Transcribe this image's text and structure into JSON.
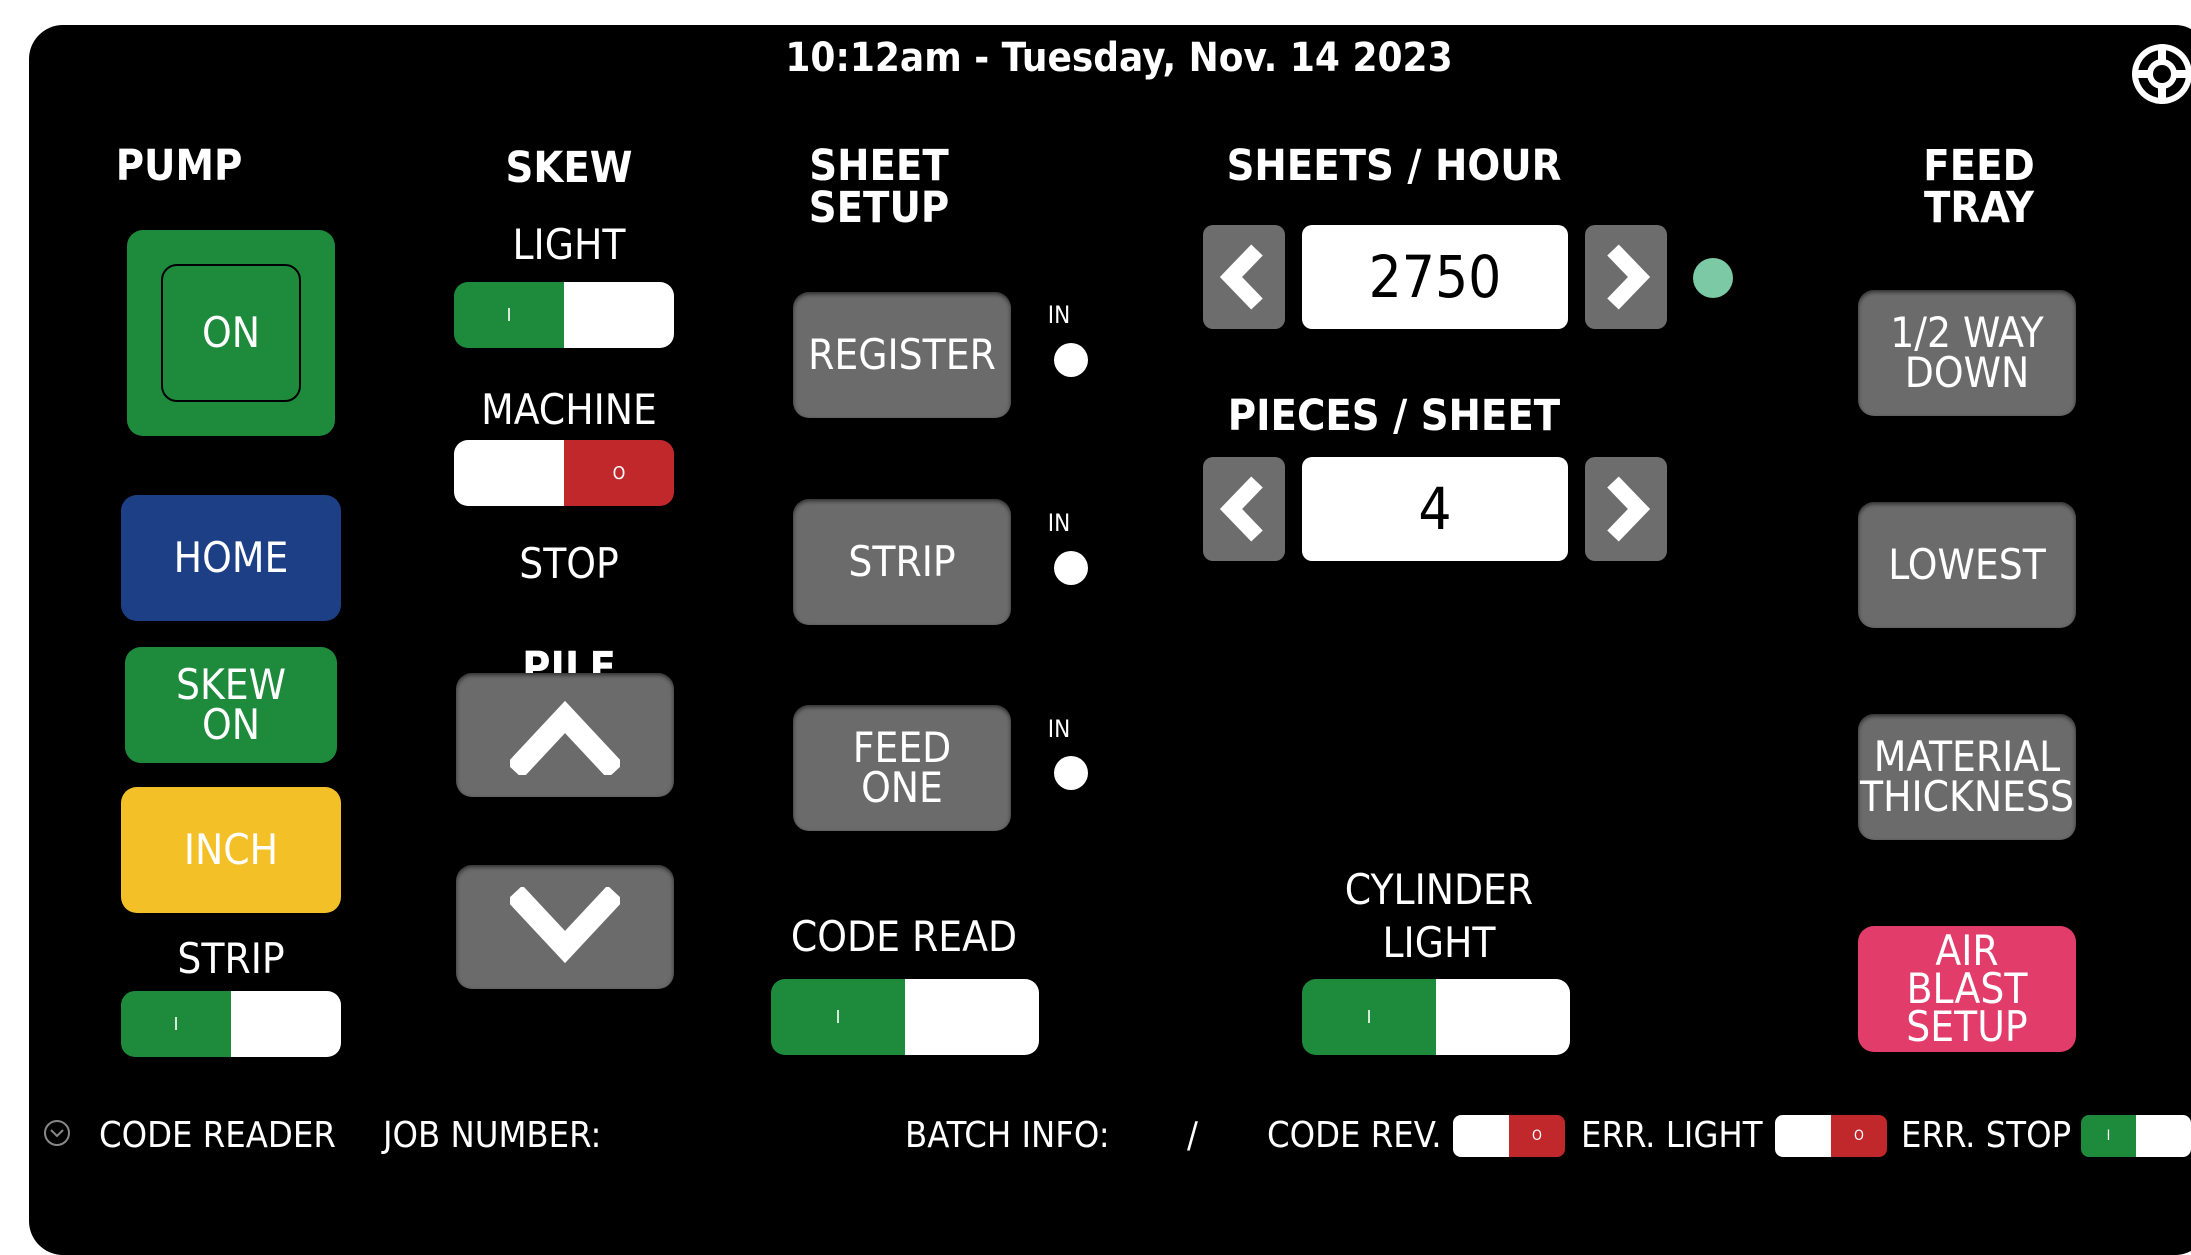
{
  "header": {
    "datetime": "10:12am - Tuesday, Nov. 14 2023",
    "settings_icon": "lifebuoy-icon"
  },
  "pump": {
    "title": "PUMP",
    "on_label": "ON",
    "home_label": "HOME",
    "skew_on_label": "SKEW ON",
    "inch_label": "INCH",
    "strip_label": "STRIP",
    "strip_toggle_on": true
  },
  "skew": {
    "title": "SKEW",
    "light_label": "LIGHT",
    "light_toggle_on": true,
    "machine_label": "MACHINE",
    "stop_label": "STOP",
    "machine_toggle_on": false
  },
  "pile": {
    "title": "PILE",
    "up_icon": "chevron-up-icon",
    "down_icon": "chevron-down-icon"
  },
  "sheet_setup": {
    "title_line1": "SHEET",
    "title_line2": "SETUP",
    "register_label": "REGISTER",
    "strip_label": "STRIP",
    "feed_one_line1": "FEED",
    "feed_one_line2": "ONE",
    "in_label": "IN",
    "code_read_label": "CODE READ",
    "code_read_toggle_on": true
  },
  "sheets_hour": {
    "title": "SHEETS / HOUR",
    "value": "2750",
    "status_color": "#7cc9a5"
  },
  "pieces_sheet": {
    "title": "PIECES / SHEET",
    "value": "4"
  },
  "cylinder": {
    "line1": "CYLINDER",
    "line2": "LIGHT",
    "toggle_on": true
  },
  "feed_tray": {
    "title_line1": "FEED",
    "title_line2": "TRAY",
    "half_way_line1": "1/2 WAY",
    "half_way_line2": "DOWN",
    "lowest_label": "LOWEST",
    "material_line1": "MATERIAL",
    "material_line2": "THICKNESS",
    "air_line1": "AIR",
    "air_line2": "BLAST",
    "air_line3": "SETUP"
  },
  "footer": {
    "code_reader_label": "CODE READER",
    "code_reader_icon": "chevron-down-circle-icon",
    "job_number_label": "JOB NUMBER:",
    "batch_info_label": "BATCH INFO:",
    "batch_sep": "/",
    "code_rev_label": "CODE REV.",
    "err_light_label": "ERR. LIGHT",
    "err_stop_label": "ERR. STOP"
  },
  "toggle_marks": {
    "on": "I",
    "off": "O"
  },
  "colors": {
    "green": "#1e8a3c",
    "blue": "#1d3f86",
    "yellow": "#f4c028",
    "pink": "#e23c6b",
    "gray": "#6b6b6b",
    "red": "#c0282c"
  }
}
